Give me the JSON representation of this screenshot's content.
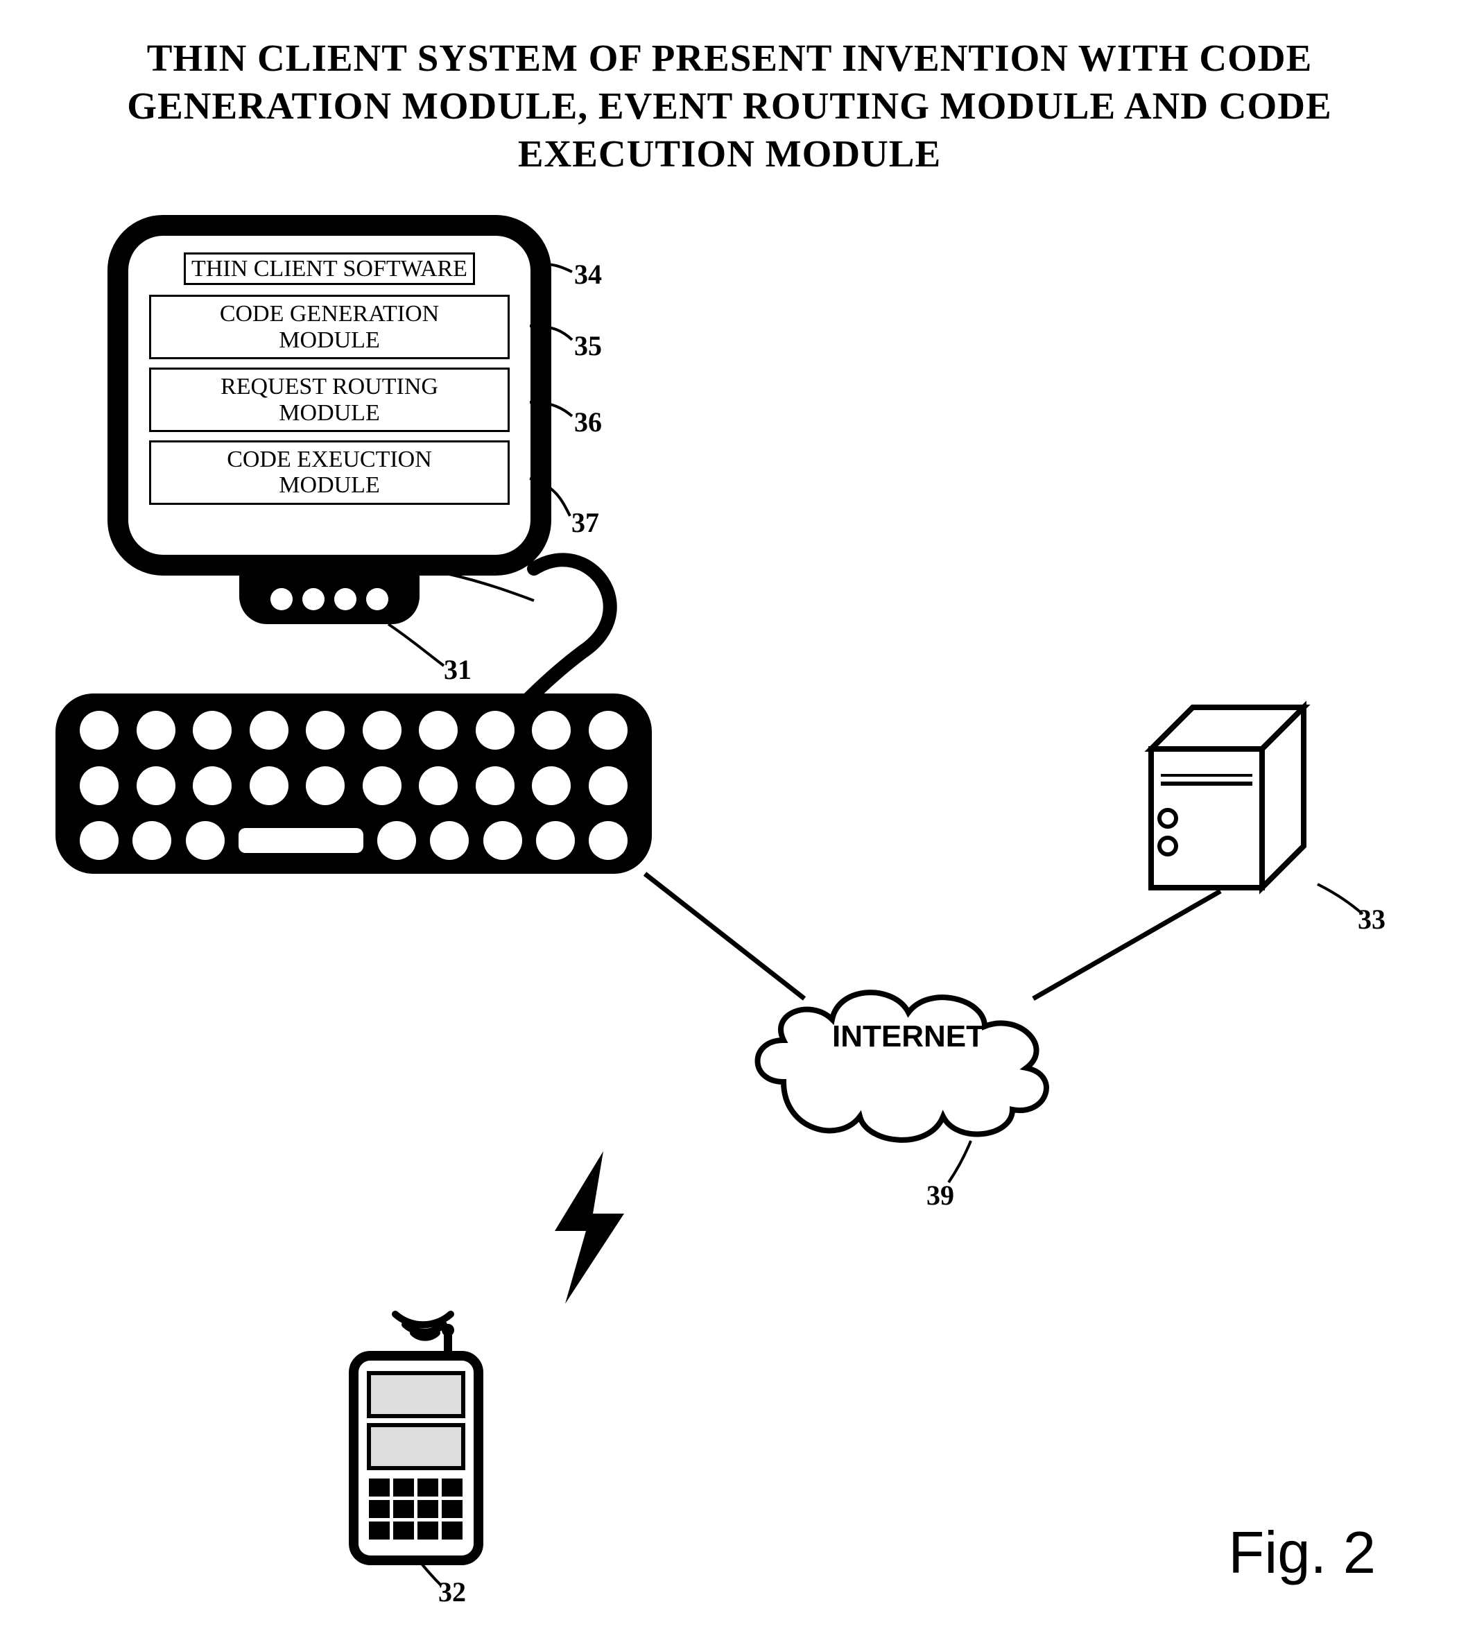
{
  "title_line1": "THIN CLIENT SYSTEM OF PRESENT INVENTION WITH CODE",
  "title_line2": "GENERATION MODULE, EVENT ROUTING MODULE AND CODE",
  "title_line3": "EXECUTION MODULE",
  "modules": {
    "m0": "THIN CLIENT SOFTWARE",
    "m1a": "CODE GENERATION",
    "m1b": "MODULE",
    "m2a": "REQUEST ROUTING",
    "m2b": "MODULE",
    "m3a": "CODE EXEUCTION",
    "m3b": "MODULE"
  },
  "cloud_label": "INTERNET",
  "figure_label": "Fig. 2",
  "refs": {
    "r31": "31",
    "r32": "32",
    "r33": "33",
    "r34": "34",
    "r35": "35",
    "r36": "36",
    "r37": "37",
    "r39": "39"
  }
}
